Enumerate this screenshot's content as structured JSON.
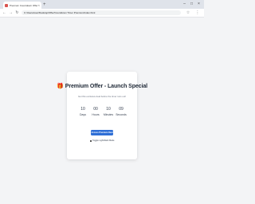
{
  "browser": {
    "tab_title": "Premium Countdown Offer",
    "tab_close": "×",
    "new_tab": "+",
    "win_minimize": "–",
    "win_maximize": "□",
    "win_close": "×",
    "nav_back": "←",
    "nav_forward": "→",
    "nav_reload": "↻",
    "url": "C:/Users/user/Desktop/Offer/Countdown Timer Premium/index.html",
    "star": "☆",
    "menu": "⋮"
  },
  "offer": {
    "gift_icon": "🎁",
    "title": "Premium Offer - Launch Special",
    "subtitle": "Get this exclusive deal before the timer runs out!",
    "countdown": [
      {
        "value": "10",
        "label": "Days"
      },
      {
        "value": "00",
        "label": "Hours"
      },
      {
        "value": "10",
        "label": "Minutes"
      },
      {
        "value": "09",
        "label": "Seconds"
      }
    ],
    "cta_label": "Access Premium Deal",
    "toggle_label": "Toggle Light/Dark Mode"
  }
}
